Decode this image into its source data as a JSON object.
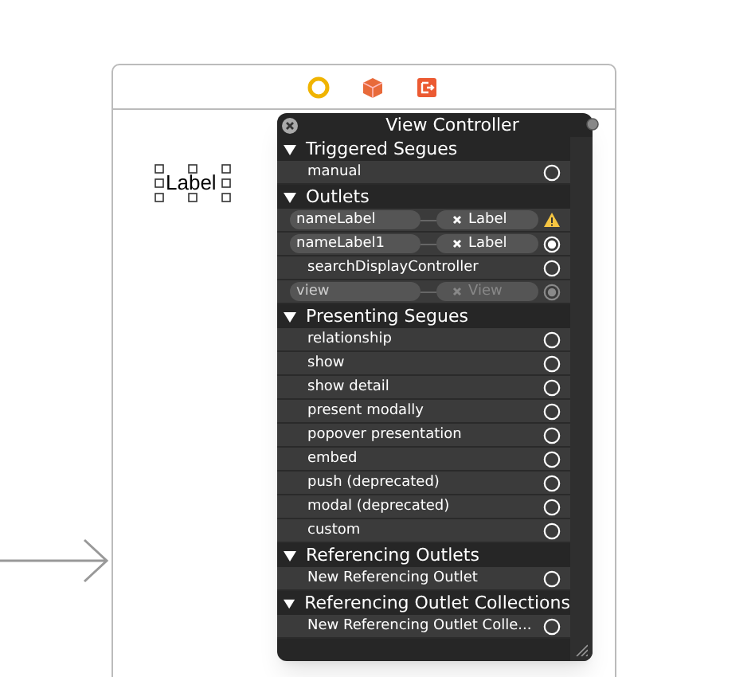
{
  "canvas_label": {
    "text": "Label",
    "selected": true
  },
  "panel": {
    "title": "View Controller",
    "sections": [
      {
        "title": "Triggered Segues",
        "expanded": true,
        "rows": [
          {
            "kind": "plain",
            "name": "manual",
            "connected": false
          }
        ]
      },
      {
        "title": "Outlets",
        "expanded": true,
        "rows": [
          {
            "kind": "connected",
            "name": "nameLabel",
            "target": "Label",
            "connected": true,
            "warning": true,
            "disabled": false
          },
          {
            "kind": "connected",
            "name": "nameLabel1",
            "target": "Label",
            "connected": true,
            "warning": false,
            "disabled": false
          },
          {
            "kind": "plain",
            "name": "searchDisplayController",
            "connected": false
          },
          {
            "kind": "connected",
            "name": "view",
            "target": "View",
            "connected": true,
            "warning": false,
            "disabled": true
          }
        ]
      },
      {
        "title": "Presenting Segues",
        "expanded": true,
        "rows": [
          {
            "kind": "plain",
            "name": "relationship",
            "connected": false
          },
          {
            "kind": "plain",
            "name": "show",
            "connected": false
          },
          {
            "kind": "plain",
            "name": "show detail",
            "connected": false
          },
          {
            "kind": "plain",
            "name": "present modally",
            "connected": false
          },
          {
            "kind": "plain",
            "name": "popover presentation",
            "connected": false
          },
          {
            "kind": "plain",
            "name": "embed",
            "connected": false
          },
          {
            "kind": "plain",
            "name": "push (deprecated)",
            "connected": false
          },
          {
            "kind": "plain",
            "name": "modal (deprecated)",
            "connected": false
          },
          {
            "kind": "plain",
            "name": "custom",
            "connected": false
          }
        ]
      },
      {
        "title": "Referencing Outlets",
        "expanded": true,
        "rows": [
          {
            "kind": "plain",
            "name": "New Referencing Outlet",
            "connected": false
          }
        ]
      },
      {
        "title": "Referencing Outlet Collections",
        "expanded": true,
        "rows": [
          {
            "kind": "plain",
            "name": "New Referencing Outlet Colle...",
            "connected": false
          }
        ]
      }
    ]
  }
}
